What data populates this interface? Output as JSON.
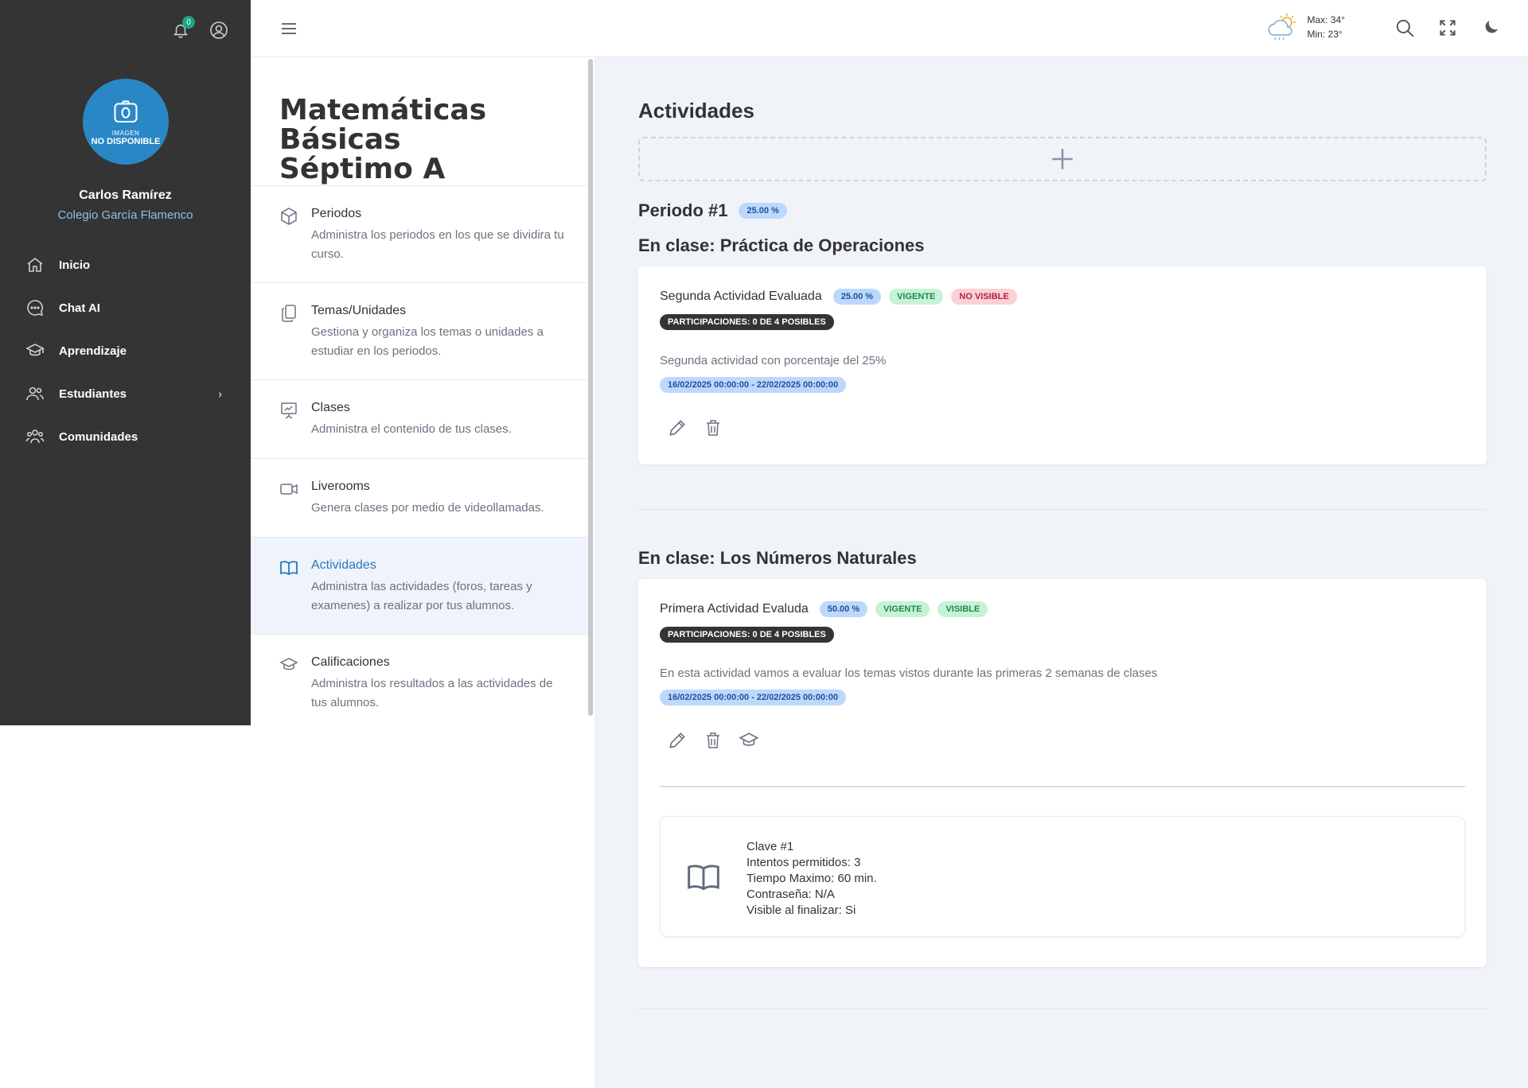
{
  "sidebar": {
    "notifications_count": "0",
    "avatar_line1": "IMAGEN",
    "avatar_line2": "NO DISPONIBLE",
    "user_name": "Carlos Ramírez",
    "school": "Colegio García Flamenco",
    "items": [
      {
        "label": "Inicio",
        "icon": "home-icon"
      },
      {
        "label": "Chat AI",
        "icon": "chat-icon"
      },
      {
        "label": "Aprendizaje",
        "icon": "graduation-cap-icon"
      },
      {
        "label": "Estudiantes",
        "icon": "users-icon",
        "chevron": "›"
      },
      {
        "label": "Comunidades",
        "icon": "community-icon"
      }
    ]
  },
  "header": {
    "weather_max": "Max: 34°",
    "weather_min": "Min: 23°"
  },
  "course": {
    "title_line1": "Matemáticas Básicas",
    "title_line2": "Séptimo A",
    "menu": [
      {
        "title": "Periodos",
        "desc": "Administra los periodos en los que se dividira tu curso.",
        "icon": "cube-icon"
      },
      {
        "title": "Temas/Unidades",
        "desc": "Gestiona y organiza los temas o unidades a estudiar en los periodos.",
        "icon": "documents-icon"
      },
      {
        "title": "Clases",
        "desc": "Administra el contenido de tus clases.",
        "icon": "presentation-icon"
      },
      {
        "title": "Liverooms",
        "desc": "Genera clases por medio de videollamadas.",
        "icon": "video-icon"
      },
      {
        "title": "Actividades",
        "desc": "Administra las actividades (foros, tareas y examenes) a realizar por tus alumnos.",
        "icon": "book-icon"
      },
      {
        "title": "Calificaciones",
        "desc": "Administra los resultados a las actividades de tus alumnos.",
        "icon": "graduation-cap-icon"
      }
    ]
  },
  "main": {
    "title": "Actividades",
    "period": {
      "title": "Periodo #1",
      "percent": "25.00 %"
    },
    "classes": [
      {
        "title": "En clase: Práctica de Operaciones",
        "activity": {
          "title": "Segunda Actividad Evaluada",
          "percent": "25.00 %",
          "status": "VIGENTE",
          "visibility": "NO VISIBLE",
          "participations": "PARTICIPACIONES: 0 DE 4 POSIBLES",
          "description": "Segunda actividad con porcentaje del 25%",
          "dates": "16/02/2025 00:00:00 - 22/02/2025 00:00:00"
        }
      },
      {
        "title": "En clase: Los Números Naturales",
        "activity": {
          "title": "Primera Actividad Evaluda",
          "percent": "50.00 %",
          "status": "VIGENTE",
          "visibility": "VISIBLE",
          "participations": "PARTICIPACIONES: 0 DE 4 POSIBLES",
          "description": "En esta actividad vamos a evaluar los temas vistos durante las primeras 2 semanas de clases",
          "dates": "16/02/2025 00:00:00 - 22/02/2025 00:00:00",
          "detail": {
            "line1": "Clave #1",
            "line2": "Intentos permitidos: 3",
            "line3": "Tiempo Maximo: 60 min.",
            "line4": "Contraseña: N/A",
            "line5": "Visible al finalizar: Si"
          }
        }
      }
    ]
  }
}
